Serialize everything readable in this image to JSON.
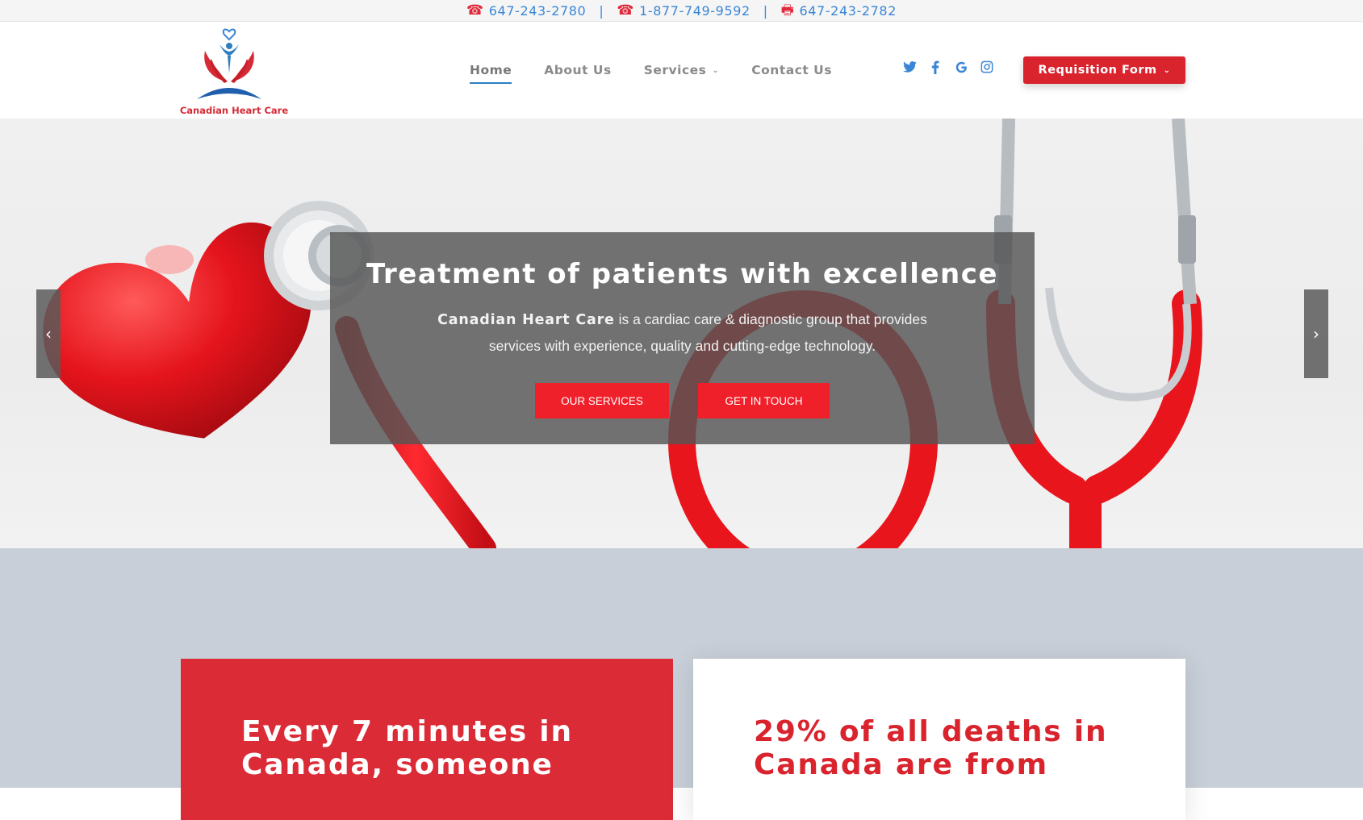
{
  "topbar": {
    "phone1": "647-243-2780",
    "phone2": "1-877-749-9592",
    "fax": "647-243-2782",
    "separator": "|"
  },
  "header": {
    "logo_text": "Canadian Heart Care",
    "nav": [
      {
        "label": "Home",
        "active": true
      },
      {
        "label": "About Us",
        "active": false
      },
      {
        "label": "Services",
        "active": false,
        "dropdown": true
      },
      {
        "label": "Contact Us",
        "active": false
      }
    ],
    "social": [
      {
        "name": "twitter-icon",
        "glyph": "🐦"
      },
      {
        "name": "facebook-icon",
        "glyph": "f"
      },
      {
        "name": "google-icon",
        "glyph": "G"
      },
      {
        "name": "instagram-icon",
        "glyph": "◎"
      }
    ],
    "requisition_label": "Requisition Form"
  },
  "hero": {
    "title": "Treatment of patients with excellence",
    "brand": "Canadian Heart Care",
    "description": "is a cardiac care & diagnostic group that provides services with experience, quality and cutting-edge technology.",
    "btn_services": "OUR SERVICES",
    "btn_contact": "GET IN TOUCH",
    "prev": "‹",
    "next": "›"
  },
  "stats": {
    "card1": "Every 7 minutes in Canada, someone",
    "card2": "29% of all deaths in Canada are from"
  },
  "colors": {
    "brand_red": "#d9232d",
    "link_blue": "#3a86d6",
    "section_bg": "#c8cfd8"
  }
}
